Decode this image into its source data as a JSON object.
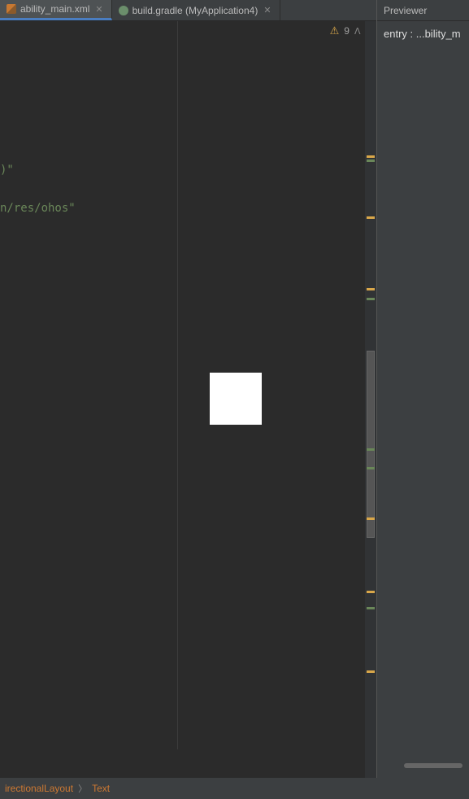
{
  "tabs": {
    "active": {
      "label": "ability_main.xml"
    },
    "inactive": {
      "label": "build.gradle (MyApplication4)"
    }
  },
  "previewer": {
    "title": "Previewer",
    "entry_text": "entry : ...bility_m"
  },
  "code": {
    "line1": ")\"",
    "line2": "n/res/ohos\""
  },
  "warnings": {
    "count": "9"
  },
  "breadcrumb": {
    "item1": "irectionalLayout",
    "item2": "Text"
  }
}
